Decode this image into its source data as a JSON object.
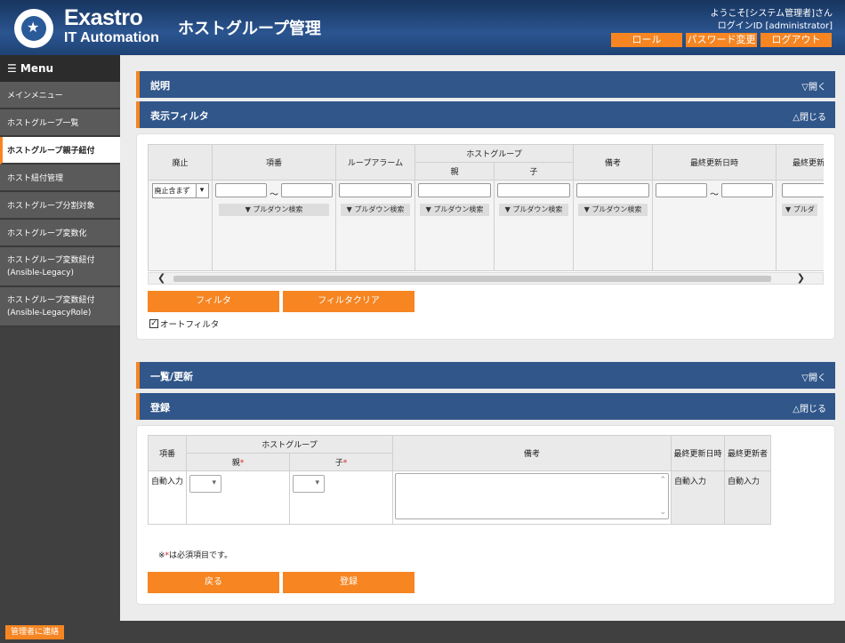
{
  "header": {
    "logo_line1": "Exastro",
    "logo_line2": "IT Automation",
    "title": "ホストグループ管理",
    "welcome": "ようこそ[システム管理者]さん",
    "login_id": "ログインID [administrator]",
    "buttons": {
      "role": "ロール",
      "password": "パスワード変更",
      "logout": "ログアウト"
    }
  },
  "sidebar": {
    "menu_label": "☰ Menu",
    "items": [
      {
        "label": "メインメニュー"
      },
      {
        "label": "ホストグループ一覧"
      },
      {
        "label": "ホストグループ親子紐付"
      },
      {
        "label": "ホスト紐付管理"
      },
      {
        "label": "ホストグループ分割対象"
      },
      {
        "label": "ホストグループ変数化"
      },
      {
        "label": "ホストグループ変数紐付\n(Ansible-Legacy)"
      },
      {
        "label": "ホストグループ変数紐付\n(Ansible-LegacyRole)"
      }
    ]
  },
  "panels": {
    "description": {
      "title": "説明",
      "toggle": "▽開く"
    },
    "filter": {
      "title": "表示フィルタ",
      "toggle": "△閉じる"
    },
    "list": {
      "title": "一覧/更新",
      "toggle": "▽開く"
    },
    "register": {
      "title": "登録",
      "toggle": "△閉じる"
    }
  },
  "filter": {
    "headers": {
      "discard": "廃止",
      "item_no": "項番",
      "loop_alarm": "ループアラーム",
      "host_group": "ホストグループ",
      "parent": "親",
      "child": "子",
      "note": "備考",
      "last_updated": "最終更新日時",
      "last_updated_by": "最終更新"
    },
    "discard_select": "廃止含まず",
    "tilde": "～",
    "pulldown": "▼ プルダウン検索",
    "pulldown_cut": "▼ プルダ",
    "filter_button": "フィルタ",
    "clear_button": "フィルタクリア",
    "auto_filter": "オートフィルタ"
  },
  "register": {
    "headers": {
      "item_no": "項番",
      "host_group": "ホストグループ",
      "parent": "親",
      "child": "子",
      "req": "*",
      "note": "備考",
      "last_updated": "最終更新日時",
      "last_updated_by": "最終更新者"
    },
    "auto_input": "自動入力",
    "required_note_prefix": "※",
    "required_note_star": "*",
    "required_note_suffix": "は必須項目です。",
    "back_button": "戻る",
    "register_button": "登録"
  },
  "footer": {
    "contact": "管理者に連絡"
  },
  "colors": {
    "header_blue": "#2b5590",
    "panel_blue": "#30568a",
    "accent_orange": "#f68522",
    "sidebar_dark": "#404040"
  }
}
